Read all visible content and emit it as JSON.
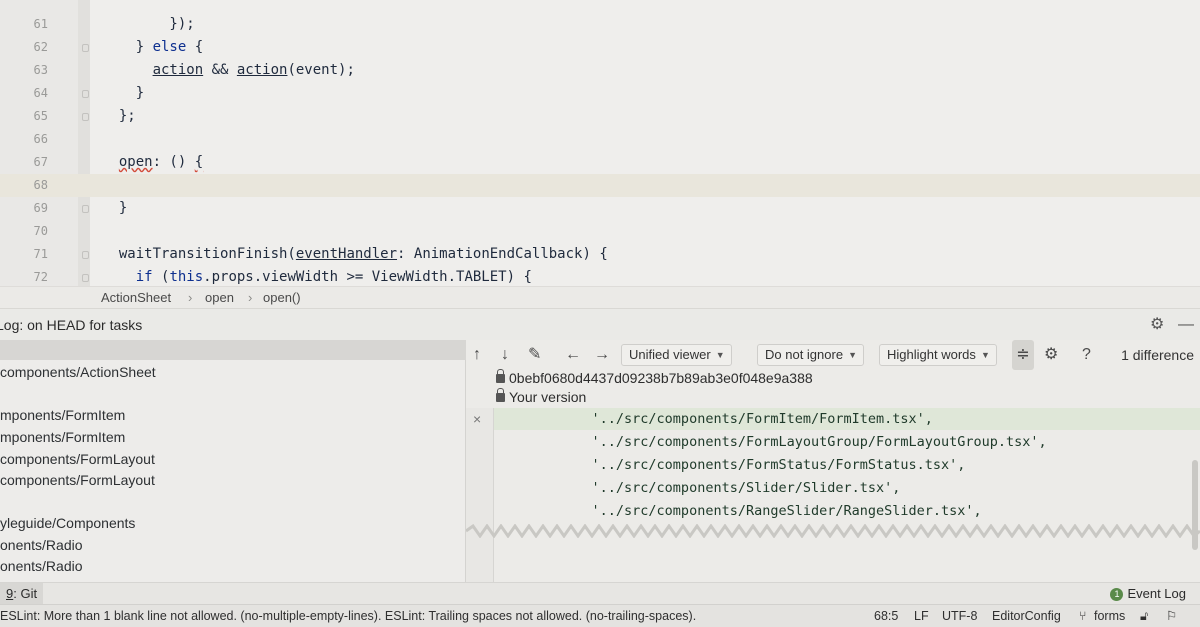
{
  "editor": {
    "lines": [
      {
        "num": "61",
        "html_parts": [
          {
            "t": "        });",
            "c": ""
          }
        ]
      },
      {
        "num": "62",
        "html_parts": [
          {
            "t": "    } ",
            "c": ""
          },
          {
            "t": "else",
            "c": "kw"
          },
          {
            "t": " {",
            "c": ""
          }
        ]
      },
      {
        "num": "63",
        "html_parts": [
          {
            "t": "      ",
            "c": ""
          },
          {
            "t": "action",
            "c": "ul"
          },
          {
            "t": " && ",
            "c": ""
          },
          {
            "t": "action",
            "c": "ul"
          },
          {
            "t": "(event);",
            "c": ""
          }
        ]
      },
      {
        "num": "64",
        "html_parts": [
          {
            "t": "    }",
            "c": ""
          }
        ]
      },
      {
        "num": "65",
        "html_parts": [
          {
            "t": "  };",
            "c": ""
          }
        ]
      },
      {
        "num": "66",
        "html_parts": [
          {
            "t": "",
            "c": ""
          }
        ]
      },
      {
        "num": "67",
        "html_parts": [
          {
            "t": "  ",
            "c": ""
          },
          {
            "t": "open",
            "c": "err"
          },
          {
            "t": ": () ",
            "c": ""
          },
          {
            "t": "{",
            "c": "err"
          }
        ]
      },
      {
        "num": "68",
        "html_parts": [
          {
            "t": "",
            "c": ""
          }
        ]
      },
      {
        "num": "69",
        "html_parts": [
          {
            "t": "  }",
            "c": ""
          }
        ]
      },
      {
        "num": "70",
        "html_parts": [
          {
            "t": "",
            "c": ""
          }
        ]
      },
      {
        "num": "71",
        "html_parts": [
          {
            "t": "  waitTransitionFinish(",
            "c": ""
          },
          {
            "t": "eventHandler",
            "c": "ul"
          },
          {
            "t": ": AnimationEndCallback) {",
            "c": ""
          }
        ]
      },
      {
        "num": "72",
        "html_parts": [
          {
            "t": "    ",
            "c": ""
          },
          {
            "t": "if",
            "c": "kw"
          },
          {
            "t": " (",
            "c": ""
          },
          {
            "t": "this",
            "c": "kw"
          },
          {
            "t": ".props.viewWidth >= ViewWidth.TABLET) {",
            "c": ""
          }
        ]
      }
    ]
  },
  "breadcrumb": {
    "items": [
      "ActionSheet",
      "open",
      "open()"
    ],
    "separator": "›"
  },
  "log_panel": {
    "title": "Log: on HEAD for tasks",
    "settings_icon": "gear-icon",
    "minimize_icon": "minimize-icon"
  },
  "left_list": {
    "items": [
      "components/ActionSheet",
      "mponents/FormItem",
      "mponents/FormItem",
      "components/FormLayout",
      "components/FormLayout",
      "yleguide/Components",
      "onents/Radio",
      "onents/Radio"
    ]
  },
  "diff": {
    "viewer_label": "Unified viewer",
    "ignore_label": "Do not ignore",
    "highlight_label": "Highlight words",
    "question_label": "?",
    "difference_count": "1 difference",
    "revision_hash": "0bebf0680d4437d09238b7b89ab3e0f048e9a388",
    "your_version": "Your version",
    "rows": [
      "            '../src/components/FormItem/FormItem.tsx',",
      "            '../src/components/FormLayoutGroup/FormLayoutGroup.tsx',",
      "            '../src/components/FormStatus/FormStatus.tsx',",
      "            '../src/components/Slider/Slider.tsx',",
      "            '../src/components/RangeSlider/RangeSlider.tsx',"
    ],
    "remove_mark": "×"
  },
  "tool_stripe": {
    "git_tab_num": "9",
    "git_tab_label": ": Git",
    "event_log_label": "Event Log",
    "event_log_count": "1"
  },
  "status_bar": {
    "message": "ESLint: More than 1 blank line not allowed. (no-multiple-empty-lines). ESLint: Trailing spaces not allowed. (no-trailing-spaces).",
    "position": "68:5",
    "line_ending": "LF",
    "encoding": "UTF-8",
    "editor_config": "EditorConfig",
    "branch": "forms"
  },
  "colors": {
    "keyword": "#0d2f8f",
    "error_underline": "#d24b3a",
    "added_line_bg": "#dfe7d8"
  }
}
